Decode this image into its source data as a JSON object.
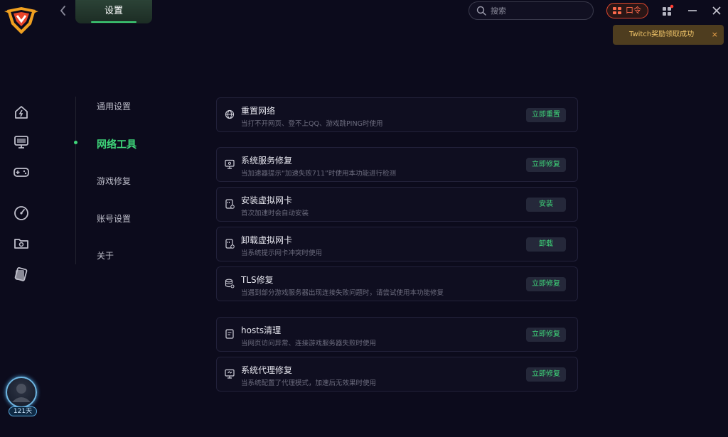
{
  "header": {
    "tab_label": "设置",
    "search_placeholder": "搜索",
    "code_button_label": "口令"
  },
  "toast": {
    "message": "Twitch奖励领取成功",
    "close_label": "×"
  },
  "rail": {
    "icons": [
      "home-icon",
      "monitor-icon",
      "gamepad-icon",
      "speedometer-icon",
      "folder-icon",
      "cards-icon"
    ],
    "avatar_days": "121天"
  },
  "nav": {
    "items": [
      {
        "label": "通用设置"
      },
      {
        "label": "网络工具"
      },
      {
        "label": "游戏修复"
      },
      {
        "label": "账号设置"
      },
      {
        "label": "关于"
      }
    ],
    "active_index": 1
  },
  "tools": [
    {
      "icon": "globe-icon",
      "title": "重置网络",
      "desc": "当打不开网页、登不上QQ、游戏跳PING时使用",
      "button": "立即重置"
    },
    {
      "icon": "monitor-repair-icon",
      "title": "系统服务修复",
      "desc": "当加速器提示“加速失败711”时使用本功能进行检测",
      "button": "立即修复"
    },
    {
      "icon": "network-card-icon",
      "title": "安装虚拟网卡",
      "desc": "首次加速时会自动安装",
      "button": "安装"
    },
    {
      "icon": "network-card-icon",
      "title": "卸载虚拟网卡",
      "desc": "当系统提示网卡冲突时使用",
      "button": "卸载"
    },
    {
      "icon": "database-gear-icon",
      "title": "TLS修复",
      "desc": "当遇到部分游戏服务器出现连接失败问题时，请尝试使用本功能修复",
      "button": "立即修复"
    },
    {
      "icon": "hosts-file-icon",
      "title": "hosts清理",
      "desc": "当网页访问异常、连接游戏服务器失败时使用",
      "button": "立即修复"
    },
    {
      "icon": "proxy-monitor-icon",
      "title": "系统代理修复",
      "desc": "当系统配置了代理模式，加速后无效果时使用",
      "button": "立即修复"
    }
  ],
  "colors": {
    "background": "#0c0b1c",
    "accent_green": "#3fd77a",
    "code_red": "#e0472f",
    "toast_bg": "#4e3d1f",
    "toast_text": "#f2c66a"
  }
}
